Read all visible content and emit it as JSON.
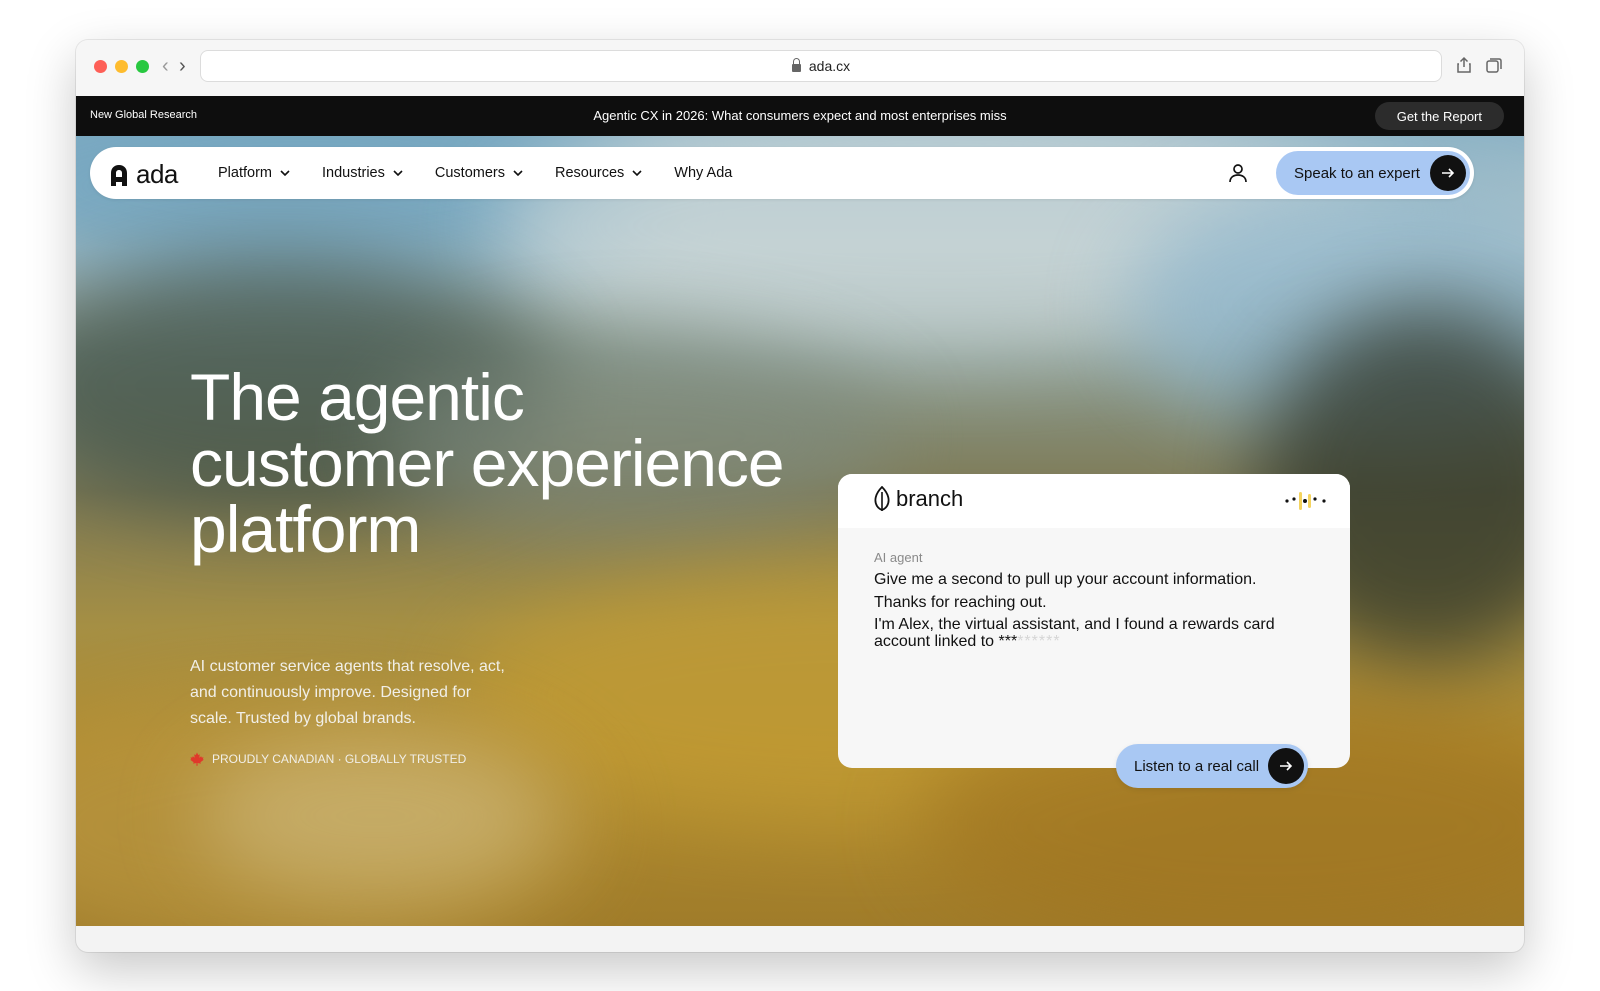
{
  "browser": {
    "url": "ada.cx"
  },
  "announcement": {
    "tag": "New Global Research",
    "headline": "Agentic CX in 2026: What consumers expect and most enterprises miss",
    "button": "Get the Report"
  },
  "nav": {
    "logo_text": "ada",
    "items": [
      {
        "label": "Platform"
      },
      {
        "label": "Industries"
      },
      {
        "label": "Customers"
      },
      {
        "label": "Resources"
      },
      {
        "label": "Why Ada"
      }
    ],
    "cta": "Speak to an expert"
  },
  "hero": {
    "title": "The agentic customer experience platform",
    "subtitle": "AI customer service agents that resolve, act, and continuously improve. Designed for scale. Trusted by global brands.",
    "tagline": "PROUDLY CANADIAN · GLOBALLY TRUSTED"
  },
  "demo_card": {
    "brand": "branch",
    "speaker": "AI agent",
    "messages": [
      "Give me a second to pull up your account information.",
      "Thanks for reaching out.",
      "I'm Alex, the virtual assistant, and I found a rewards card account linked to ***"
    ],
    "masked_suffix": "******",
    "button": "Listen to a real call"
  },
  "colors": {
    "cta_blue": "#a9c8f3",
    "announce_bg": "#0e0e0e",
    "maple_red": "#e0392b"
  }
}
